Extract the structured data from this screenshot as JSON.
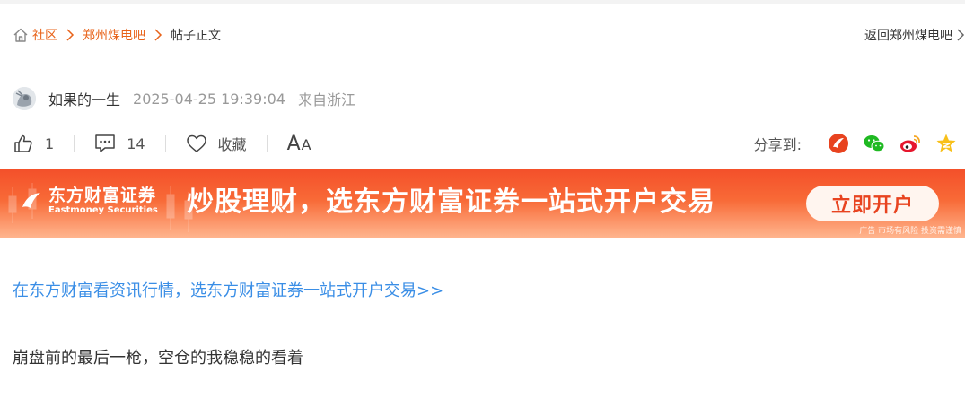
{
  "breadcrumb": {
    "home_icon": "home-icon",
    "items": [
      {
        "label": "社区"
      },
      {
        "label": "郑州煤电吧"
      }
    ],
    "current": "帖子正文",
    "link_color": "#e8631a"
  },
  "back_link": {
    "label": "返回郑州煤电吧"
  },
  "author": {
    "name": "如果的一生",
    "time": "2025-04-25 19:39:04",
    "from": "来自浙江"
  },
  "actions": {
    "like_count": "1",
    "comment_count": "14",
    "favorite_label": "收藏",
    "font_big": "A",
    "font_small": "A"
  },
  "share": {
    "label": "分享到:",
    "targets": [
      "eastmoney-icon",
      "wechat-icon",
      "weibo-icon",
      "qzone-icon"
    ]
  },
  "banner": {
    "brand_cn": "东方财富证券",
    "brand_en": "Eastmoney Securities",
    "slogan": "炒股理财，选东方财富证券一站式开户交易",
    "cta": "立即开户",
    "disclaimer": "广告 市场有风险 投资需谨慎",
    "colors": {
      "start": "#f4502a",
      "end": "#ffb58e",
      "cta_text": "#e8431f"
    }
  },
  "content": {
    "promo_link": "在东方财富看资讯行情，选东方财富证券一站式开户交易>>",
    "text": "崩盘前的最后一枪，空仓的我稳稳的看着",
    "link_color": "#3a8ee6"
  }
}
